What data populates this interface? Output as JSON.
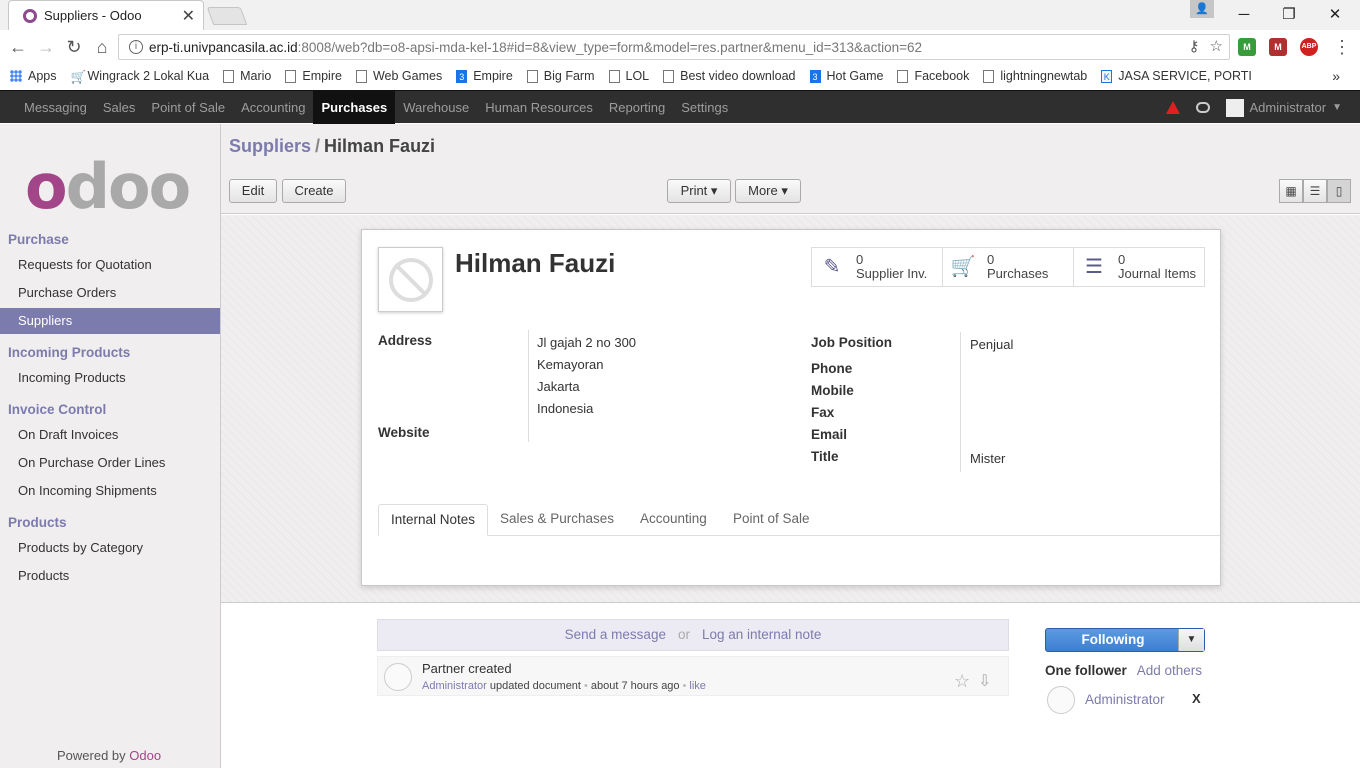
{
  "browser": {
    "tab_title": "Suppliers - Odoo",
    "url_host": "erp-ti.univpancasila.ac.id",
    "url_rest": ":8008/web?db=o8-apsi-mda-kel-18#id=8&view_type=form&model=res.partner&menu_id=313&action=62",
    "bookmarks": [
      "Apps",
      "Wingrack 2 Lokal Kua",
      "Mario",
      "Empire",
      "Web Games",
      "Empire",
      "Big Farm",
      "LOL",
      "Best video download",
      "Hot Game",
      "Facebook",
      "lightningnewtab",
      "JASA SERVICE, PORTI"
    ],
    "extensions": [
      "M",
      "M",
      "ABP"
    ]
  },
  "topmenu": {
    "items": [
      "Messaging",
      "Sales",
      "Point of Sale",
      "Accounting",
      "Purchases",
      "Warehouse",
      "Human Resources",
      "Reporting",
      "Settings"
    ],
    "active": "Purchases",
    "user": "Administrator"
  },
  "sidebar": {
    "sections": [
      {
        "title": "Purchase",
        "items": [
          "Requests for Quotation",
          "Purchase Orders",
          "Suppliers"
        ]
      },
      {
        "title": "Incoming Products",
        "items": [
          "Incoming Products"
        ]
      },
      {
        "title": "Invoice Control",
        "items": [
          "On Draft Invoices",
          "On Purchase Order Lines",
          "On Incoming Shipments"
        ]
      },
      {
        "title": "Products",
        "items": [
          "Products by Category",
          "Products"
        ]
      }
    ],
    "active_item": "Suppliers",
    "powered_by": "Powered by",
    "powered_brand": "Odoo"
  },
  "control_panel": {
    "breadcrumb_parent": "Suppliers",
    "breadcrumb_sep": "/",
    "breadcrumb_current": "Hilman Fauzi",
    "edit_label": "Edit",
    "create_label": "Create",
    "print_label": "Print ▾",
    "more_label": "More ▾"
  },
  "form": {
    "name": "Hilman Fauzi",
    "smart_buttons": [
      {
        "count": "0",
        "label": "Supplier Inv.",
        "icon": "edit-icon"
      },
      {
        "count": "0",
        "label": "Purchases",
        "icon": "cart-icon"
      },
      {
        "count": "0",
        "label": "Journal Items",
        "icon": "list-icon"
      }
    ],
    "labels": {
      "address": "Address",
      "website": "Website",
      "job_position": "Job Position",
      "phone": "Phone",
      "mobile": "Mobile",
      "fax": "Fax",
      "email": "Email",
      "title": "Title"
    },
    "address_lines": [
      "Jl gajah 2 no 300",
      "Kemayoran",
      "Jakarta",
      "Indonesia"
    ],
    "job_position": "Penjual",
    "title": "Mister",
    "tabs": [
      "Internal Notes",
      "Sales & Purchases",
      "Accounting",
      "Point of Sale"
    ],
    "active_tab": "Internal Notes"
  },
  "chatter": {
    "send_message": "Send a message",
    "or": "or",
    "log_note": "Log an internal note",
    "message": {
      "title": "Partner created",
      "author": "Administrator",
      "action": "updated document",
      "time": "about 7 hours ago",
      "like": "like"
    },
    "following_label": "Following",
    "followers_count": "One follower",
    "add_others": "Add others",
    "follower_name": "Administrator",
    "remove_label": "X"
  },
  "colors": {
    "brand": "#7c7bad",
    "odoo_purple": "#a24689",
    "topbar": "#2f2f2f",
    "follow_btn": "#3d7ed2"
  }
}
